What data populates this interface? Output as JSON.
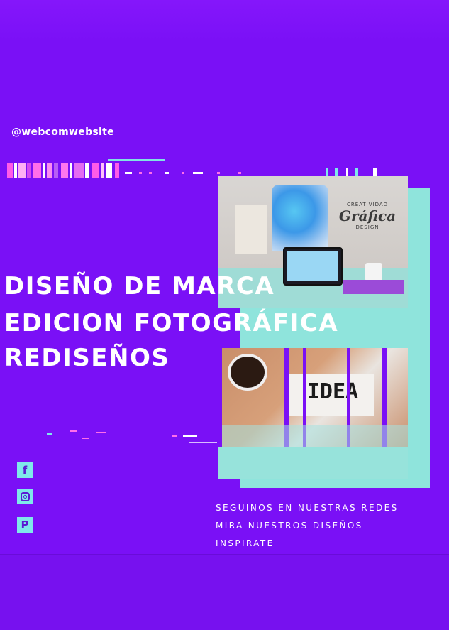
{
  "handle": "@webcomwebsite",
  "headlines": [
    "DISEÑO DE MARCA",
    "EDICION FOTOGRÁFICA",
    "REDISEÑOS"
  ],
  "taglines": [
    "SEGUINOS EN NUESTRAS REDES",
    "MIRA NUESTROS DISEÑOS",
    "INSPIRATE"
  ],
  "photo": {
    "logo_top": "CREATIVIDAD",
    "logo_main": "Gráfica",
    "logo_bottom": "DESIGN",
    "board_word": "IDEA"
  },
  "social_icons": [
    "facebook-icon",
    "instagram-icon",
    "pinterest-icon"
  ],
  "colors": {
    "background": "#7a10f6",
    "accent_teal": "#7fe8ea",
    "accent_magenta": "#ff4fd8",
    "text": "#ffffff"
  }
}
